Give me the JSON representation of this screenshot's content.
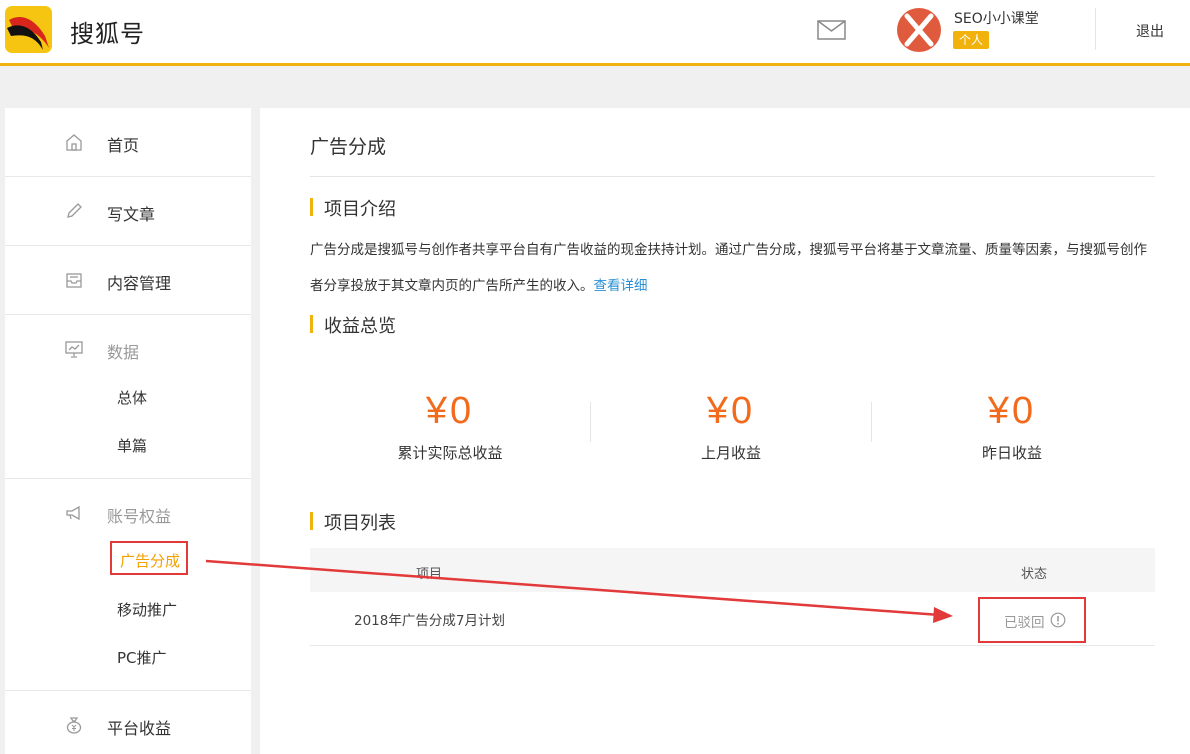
{
  "header": {
    "brand": "搜狐号",
    "username": "SEO小小课堂",
    "user_tag": "个人",
    "logout_label": "退出"
  },
  "sidebar": {
    "home": "首页",
    "write": "写文章",
    "content": "内容管理",
    "data": "数据",
    "data_sub": [
      "总体",
      "单篇"
    ],
    "rights": "账号权益",
    "rights_sub": [
      "广告分成",
      "移动推广",
      "PC推广"
    ],
    "platform_income": "平台收益"
  },
  "main": {
    "title": "广告分成",
    "intro_title": "项目介绍",
    "intro_text": "广告分成是搜狐号与创作者共享平台自有广告收益的现金扶持计划。通过广告分成，搜狐号平台将基于文章流量、质量等因素，与搜狐号创作者分享投放于其文章内页的广告所产生的收入。",
    "intro_link": "查看详细",
    "overview_title": "收益总览",
    "stats": [
      {
        "value": "¥0",
        "label": "累计实际总收益"
      },
      {
        "value": "¥0",
        "label": "上月收益"
      },
      {
        "value": "¥0",
        "label": "昨日收益"
      }
    ],
    "list_title": "项目列表",
    "table": {
      "headers": [
        "项目",
        "状态"
      ],
      "rows": [
        {
          "name": "2018年广告分成7月计划",
          "status": "已驳回"
        }
      ]
    }
  },
  "colors": {
    "accent": "#f2b20c",
    "money": "#f26a1b",
    "annotation": "#e23a3a",
    "link": "#2a90d6"
  }
}
